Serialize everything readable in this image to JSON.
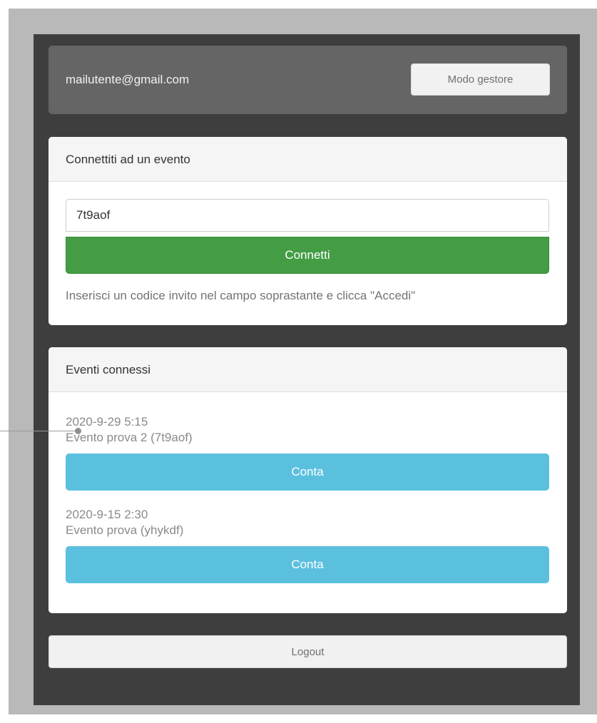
{
  "header": {
    "email": "mailutente@gmail.com",
    "manager_mode_label": "Modo gestore"
  },
  "connect_panel": {
    "title": "Connettiti ad un evento",
    "invite_code_value": "7t9aof",
    "connect_label": "Connetti",
    "help_text": "Inserisci un codice invito nel campo soprastante e clicca \"Accedi\""
  },
  "events_panel": {
    "title": "Eventi connessi",
    "events": [
      {
        "date": "2020-9-29 5:15",
        "name": "Evento prova 2 (7t9aof)",
        "action_label": "Conta"
      },
      {
        "date": "2020-9-15 2:30",
        "name": "Evento prova (yhykdf)",
        "action_label": "Conta"
      }
    ]
  },
  "footer": {
    "logout_label": "Logout"
  },
  "colors": {
    "connect_button": "#449d44",
    "count_button": "#5bc0de",
    "app_background": "#3e3e3e",
    "header_background": "#656565"
  }
}
